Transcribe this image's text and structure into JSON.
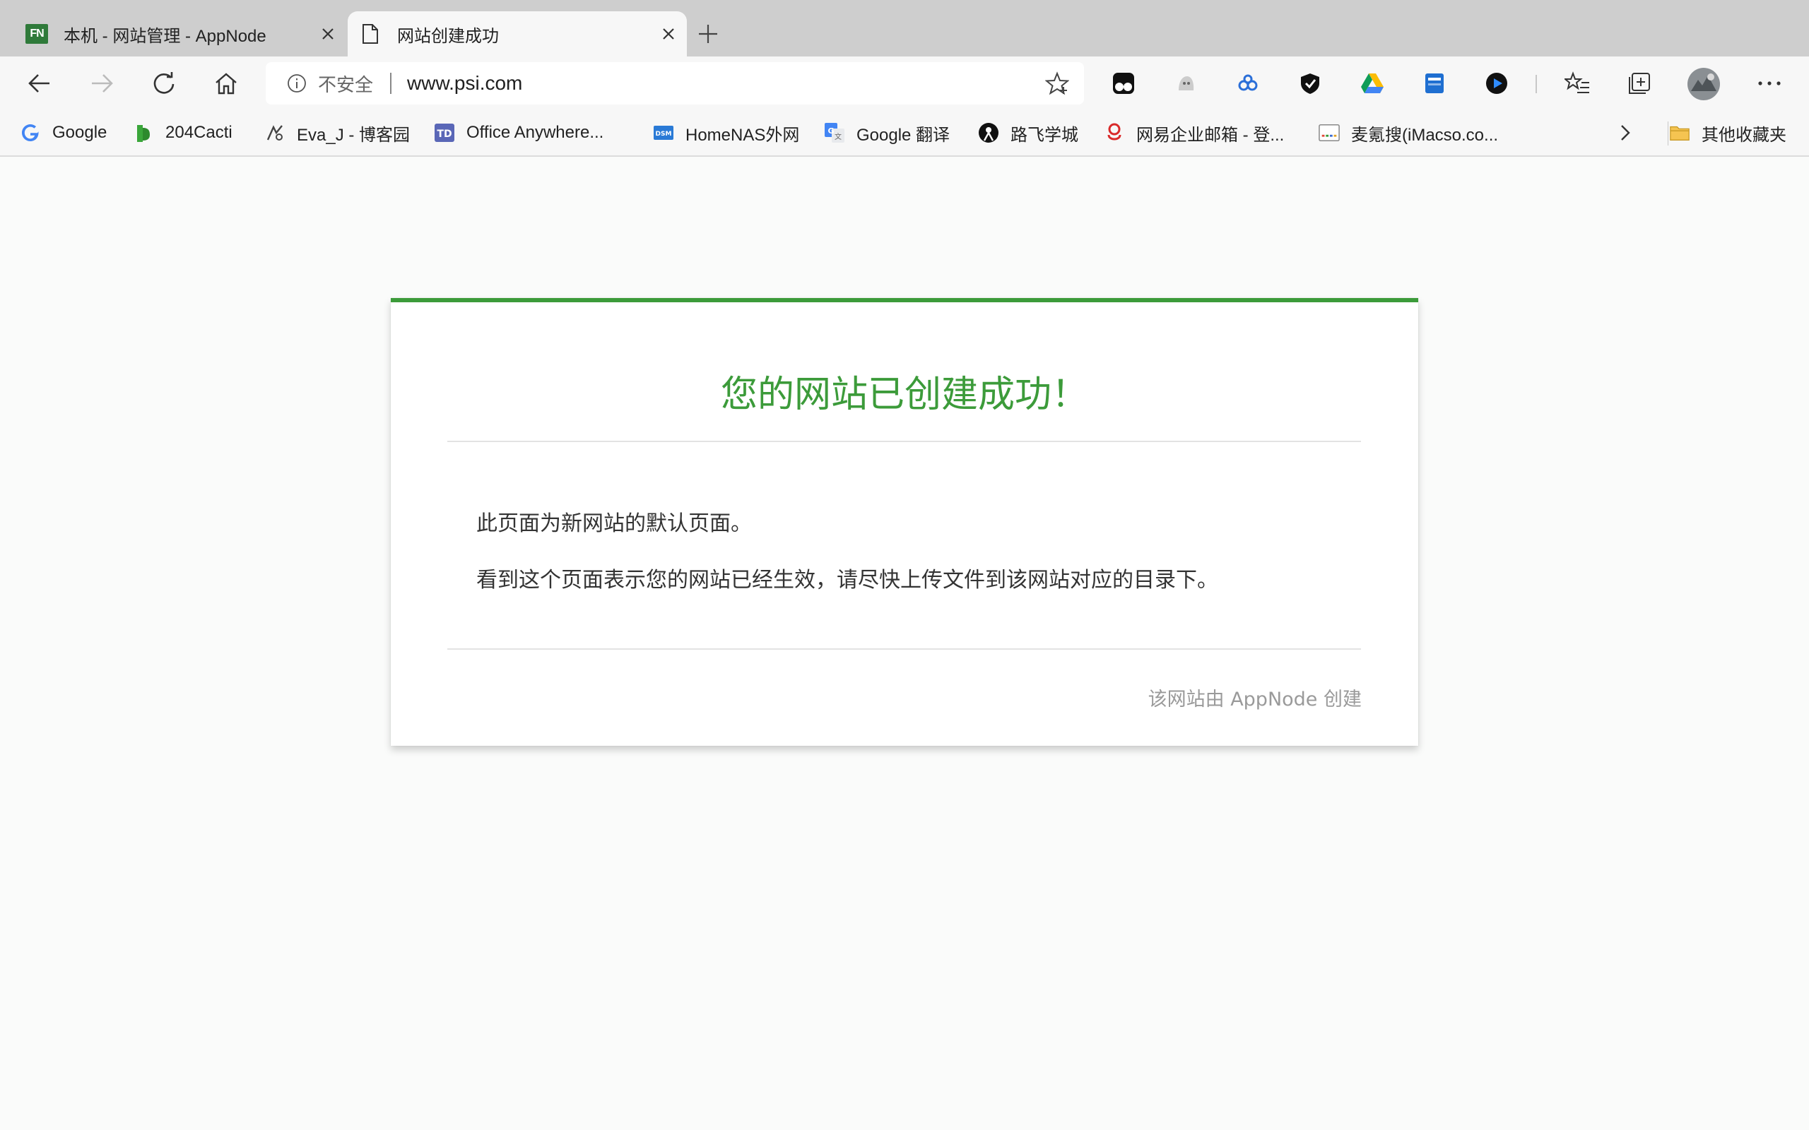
{
  "tabs": [
    {
      "title": "本机 - 网站管理 - AppNode",
      "favicon": "fn-logo-icon",
      "active": false
    },
    {
      "title": "网站创建成功",
      "favicon": "document-icon",
      "active": true
    }
  ],
  "toolbar": {
    "security_label": "不安全",
    "url": "www.psi.com"
  },
  "bookmarks": [
    {
      "label": "Google",
      "icon": "google-icon"
    },
    {
      "label": "204Cacti",
      "icon": "cacti-icon"
    },
    {
      "label": "Eva_J - 博客园",
      "icon": "blog-icon"
    },
    {
      "label": "Office Anywhere...",
      "icon": "td-icon"
    },
    {
      "label": "HomeNAS外网",
      "icon": "dsm-icon"
    },
    {
      "label": "Google 翻译",
      "icon": "google-translate-icon"
    },
    {
      "label": "路飞学城",
      "icon": "luffy-icon"
    },
    {
      "label": "网易企业邮箱 - 登...",
      "icon": "netease-mail-icon"
    },
    {
      "label": "麦氪搜(iMacso.co...",
      "icon": "imacso-icon"
    }
  ],
  "other_bookmarks": "其他收藏夹",
  "card": {
    "heading": "您的网站已创建成功！",
    "line1": "此页面为新网站的默认页面。",
    "line2": "看到这个页面表示您的网站已经生效，请尽快上传文件到该网站对应的目录下。",
    "footer": "该网站由 AppNode 创建"
  },
  "colors": {
    "accent_green": "#3c9b3a",
    "tabstrip": "#cecece",
    "toolbar": "#f7f7f7"
  }
}
